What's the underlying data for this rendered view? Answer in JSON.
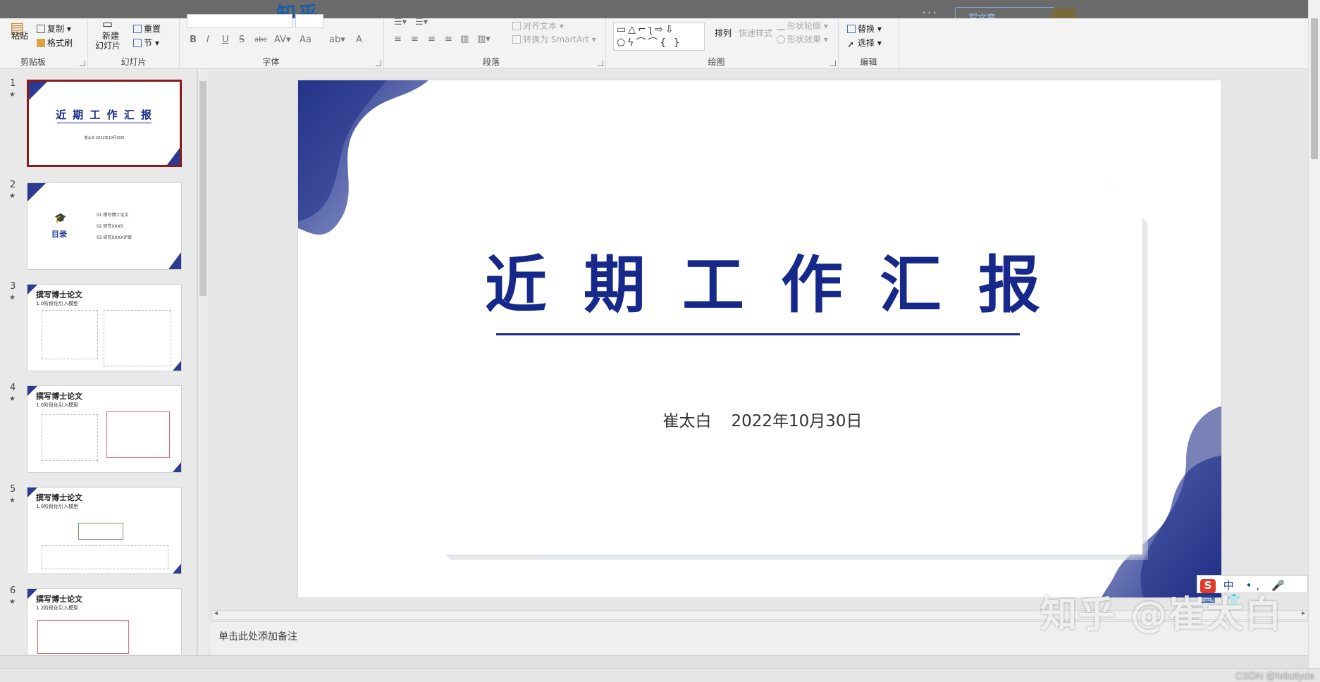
{
  "header": {
    "site_logo": "知乎",
    "more": "···",
    "write_button": "写文章"
  },
  "ribbon": {
    "clipboard": {
      "paste": "粘贴",
      "copy": "复制",
      "format_painter": "格式刷",
      "label": "剪贴板"
    },
    "slides": {
      "new_slide_line1": "新建",
      "new_slide_line2": "幻灯片",
      "reset": "重置",
      "section": "节",
      "label": "幻灯片"
    },
    "font": {
      "bold": "B",
      "italic": "I",
      "underline": "U",
      "strike": "S",
      "abc": "abc",
      "size_aa": "Aa",
      "font_color": "A",
      "label": "字体"
    },
    "paragraph": {
      "align_text": "对齐文本",
      "to_smartart": "转换为 SmartArt",
      "label": "段落"
    },
    "drawing": {
      "arrange": "排列",
      "quick_styles": "快速样式",
      "shape_outline": "形状轮廓",
      "shape_effects": "形状效果",
      "label": "绘图",
      "shapes_row1": "▭△⌐ʅ⇨⇩",
      "shapes_row2": "⬠ϟ⌒⌒{ }"
    },
    "editing": {
      "replace": "替换",
      "select": "选择",
      "label": "编辑"
    }
  },
  "thumbnails": [
    {
      "num": "1",
      "title": "近 期 工 作 汇 报",
      "sub": "崔太白    2022年10月30日"
    },
    {
      "num": "2",
      "title": "目录",
      "items": [
        "01  撰写博士论文",
        "02  研究XXXS",
        "03  研究XXXX评审"
      ]
    },
    {
      "num": "3",
      "title": "撰写博士论文",
      "sub": "1.0阶段化引入模型"
    },
    {
      "num": "4",
      "title": "撰写博士论文",
      "sub": "1.0阶段化引入模型"
    },
    {
      "num": "5",
      "title": "撰写博士论文",
      "sub": "1.0阶段化引入模型"
    },
    {
      "num": "6",
      "title": "撰写博士论文",
      "sub": "1.2阶段化引入模型"
    }
  ],
  "slide": {
    "title": "近期工作汇报",
    "author": "崔太白",
    "date": "2022年10月30日",
    "accent": "#16298a",
    "brand_blue": "#2a3c91"
  },
  "notes_placeholder": "单击此处添加备注",
  "ime": {
    "logo": "S",
    "mode": "中"
  },
  "watermark": "知乎 @崔太白",
  "csdn": "CSDN @felicityde"
}
